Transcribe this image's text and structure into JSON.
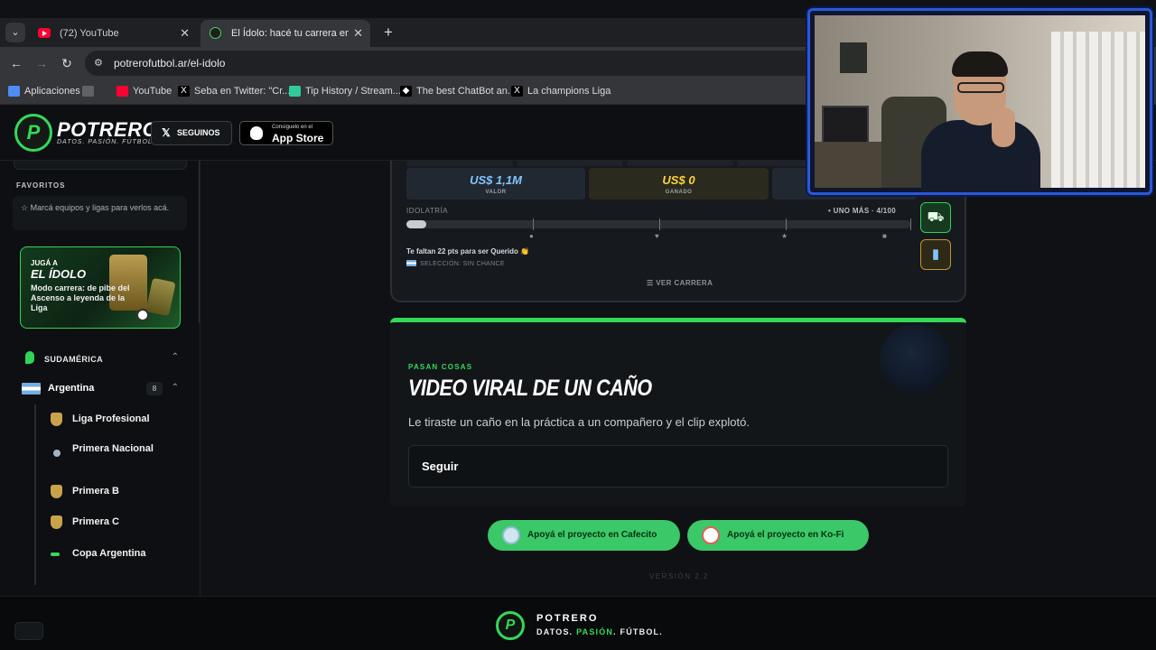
{
  "browser": {
    "tabs": [
      {
        "title": "(72) YouTube",
        "icon": "youtube-icon"
      },
      {
        "title": "El Ídolo: hacé tu carrera en la Li",
        "icon": "potrero-icon",
        "active": true
      }
    ],
    "url": "potrerofutbol.ar/el-idolo",
    "bookmarks": [
      {
        "label": "Aplicaciones",
        "icon": "apps-grid-icon"
      },
      {
        "label": "YouTube",
        "icon": "youtube-icon"
      },
      {
        "label": "Seba en Twitter: \"Cr...",
        "icon": "x-icon"
      },
      {
        "label": "Tip History / Stream...",
        "icon": "streamelements-icon"
      },
      {
        "label": "The best ChatBot an...",
        "icon": "chatbot-icon"
      },
      {
        "label": "La champions Liga",
        "icon": "x-icon"
      }
    ]
  },
  "header": {
    "brand": "POTRERO",
    "tagline": "DATOS. PASIÓN. FÚTBOL.",
    "follow_label": "SEGUINOS",
    "appstore_small": "Consíguelo en el",
    "appstore_big": "App Store"
  },
  "sidebar": {
    "favorites_title": "FAVORITOS",
    "favorites_hint": "☆  Marcá equipos y ligas para verlos acá.",
    "promo": {
      "line1": "JUGÁ A",
      "line2": "EL ÍDOLO",
      "line3": "Modo carrera: de pibe del Ascenso a leyenda de la Liga"
    },
    "region": "SUDAMÉRICA",
    "country": {
      "name": "Argentina",
      "count": "8"
    },
    "leagues": [
      {
        "name": "Liga Profesional",
        "color": "#c9a34a"
      },
      {
        "name": "Primera Nacional",
        "color": "#9fb4c4"
      },
      {
        "name": "Primera B",
        "color": "#c9a34a"
      },
      {
        "name": "Primera C",
        "color": "#c9a34a"
      },
      {
        "name": "Copa Argentina",
        "color": "#34d859"
      }
    ]
  },
  "career": {
    "stats": [
      {
        "value": "US$ 1,1M",
        "label": "VALOR"
      },
      {
        "value": "US$ 0",
        "label": "GANADO"
      }
    ],
    "idolatry_label": "IDOLATRÍA",
    "idolatry_status": "• UNO MÁS · 4/100",
    "idolatry_progress": 0.04,
    "note": "Te faltan 22 pts para ser Querido 👏",
    "selection": "SELECCIÓN: SIN CHANCE",
    "view_career": "☰  VER CARRERA"
  },
  "event": {
    "kicker": "PASAN COSAS",
    "title": "VIDEO VIRAL DE UN CAÑO",
    "description": "Le tiraste un caño en la práctica a un compañero y el clip explotó.",
    "option": "Seguir"
  },
  "support": {
    "cafecito": "Apoyá el proyecto en Cafecito",
    "kofi": "Apoyá el proyecto en Ko-Fi"
  },
  "version": "VERSIÓN 2.2",
  "footer": {
    "brand": "POTRERO",
    "tagline_parts": [
      "DATOS. ",
      "PASIÓN",
      ". FÚTBOL."
    ]
  },
  "colors": {
    "accent": "#34d859",
    "value_blue": "#7fc6ff",
    "gold": "#ffd43b"
  }
}
